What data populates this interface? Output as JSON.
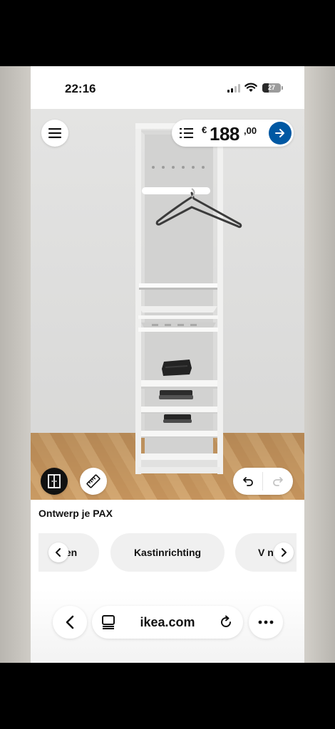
{
  "status_bar": {
    "time": "22:16",
    "battery": "27",
    "icons": [
      "cellular-signal-icon",
      "wifi-icon",
      "battery-icon"
    ]
  },
  "planner": {
    "price": {
      "currency": "€",
      "amount": "188",
      "decimals": ",00"
    },
    "icons": {
      "menu": "hamburger-menu-icon",
      "list": "numbered-list-icon",
      "go": "arrow-right-icon",
      "view": "wardrobe-doors-icon",
      "measure": "ruler-icon",
      "undo": "undo-icon",
      "redo": "redo-icon"
    },
    "colors": {
      "accent_blue": "#0058a3",
      "view_button": "#111111",
      "floor_wood": "#c99a63",
      "wall": "#e4e4e3"
    }
  },
  "design": {
    "title": "Ontwerp je PAX",
    "chips": {
      "left": "Randgevallen",
      "left_visible": "dg  en",
      "middle": "Kastinrichting",
      "right_visible": "V  nt"
    }
  },
  "browser": {
    "url": "ikea.com",
    "icons": [
      "chevron-left-icon",
      "tabs-icon",
      "reload-icon",
      "more-icon"
    ]
  }
}
